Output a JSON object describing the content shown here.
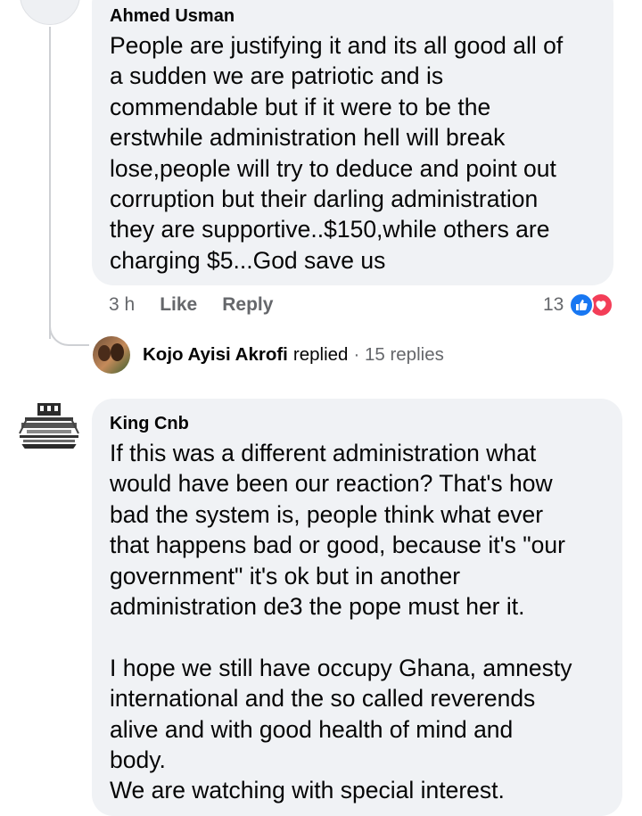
{
  "comments": [
    {
      "author": "Ahmed Usman",
      "text": "People are justifying it and its all good all of\na sudden we are patriotic and is\ncommendable but if it were to be the\nerstwhile administration hell will break\nlose,people will try to deduce and point out\ncorruption but their darling administration\nthey are supportive..$150,while others are\ncharging $5...God save us",
      "time": "3 h",
      "like_label": "Like",
      "reply_label": "Reply",
      "reaction_count": "13",
      "reactions": [
        "like-icon",
        "love-icon"
      ]
    },
    {
      "author": "King Cnb",
      "text": "If this was a different administration what\nwould have been our reaction? That's how\nbad the system is, people think what ever\nthat happens bad or good, because it's \"our\ngovernment\" it's ok but in another\nadministration de3 the pope must her it.\n\nI hope we still have occupy Ghana, amnesty\ninternational and the so called reverends\nalive and with good health of mind and\nbody.\nWe are watching with special interest."
    }
  ],
  "replies_summary": {
    "name": "Kojo Ayisi Akrofi",
    "verb": "replied",
    "count": "· 15 replies"
  },
  "colors": {
    "bubble": "#f0f2f5",
    "meta_text": "#65676b",
    "like_blue": "#1877f2",
    "love_red": "#f33e58"
  }
}
